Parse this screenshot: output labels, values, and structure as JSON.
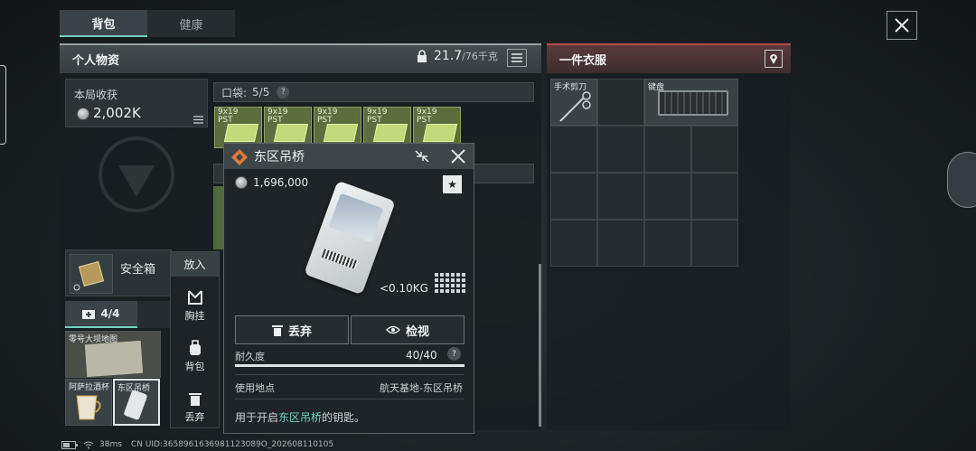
{
  "tabs": [
    {
      "label": "背包",
      "active": true
    },
    {
      "label": "健康",
      "active": false
    }
  ],
  "left_panel": {
    "title": "个人物资",
    "weight_current": "21.7",
    "weight_max": "/76千克"
  },
  "harvest": {
    "label": "本局收获",
    "value": "2,002K"
  },
  "pocket": {
    "label": "口袋:",
    "count": "5/5",
    "help": "?"
  },
  "ammo_items": [
    {
      "label": "9x19\nPST"
    },
    {
      "label": "9x19\nPST"
    },
    {
      "label": "9x19\nPST"
    },
    {
      "label": "9x19\nPST"
    },
    {
      "label": "9x19\nPST"
    }
  ],
  "safe_box": {
    "label": "安全箱"
  },
  "container_tab": {
    "label": "4/4"
  },
  "container_items": [
    {
      "label": "零号大坝地图"
    },
    {
      "label": "阿萨拉酒杯"
    },
    {
      "label": "东区吊桥"
    }
  ],
  "context_menu": {
    "title": "放入",
    "items": [
      {
        "label": "胸挂",
        "icon": "chest-rig-icon"
      },
      {
        "label": "背包",
        "icon": "backpack-icon"
      },
      {
        "label": "丢弃",
        "icon": "trash-icon"
      }
    ]
  },
  "item_popup": {
    "title": "东区吊桥",
    "price": "1,696,000",
    "weight": "<0.10KG",
    "discard_label": "丢弃",
    "inspect_label": "检视",
    "durability_label": "耐久度",
    "durability_value": "40/40",
    "durability_fraction": 1.0,
    "location_label": "使用地点",
    "location_value": "航天基地-东区吊桥",
    "desc_prefix": "用于开启",
    "desc_highlight": "东区吊桥",
    "desc_suffix": "的钥匙。",
    "highlight_color": "#6fd3c0"
  },
  "right_panel": {
    "title": "一件衣服",
    "items": [
      {
        "label": "手术剪刀"
      },
      {
        "label": "键盘"
      }
    ]
  },
  "status_bar": {
    "ping": "38ms",
    "uid": "CN UID:3658961636981123089O_202608110105"
  }
}
